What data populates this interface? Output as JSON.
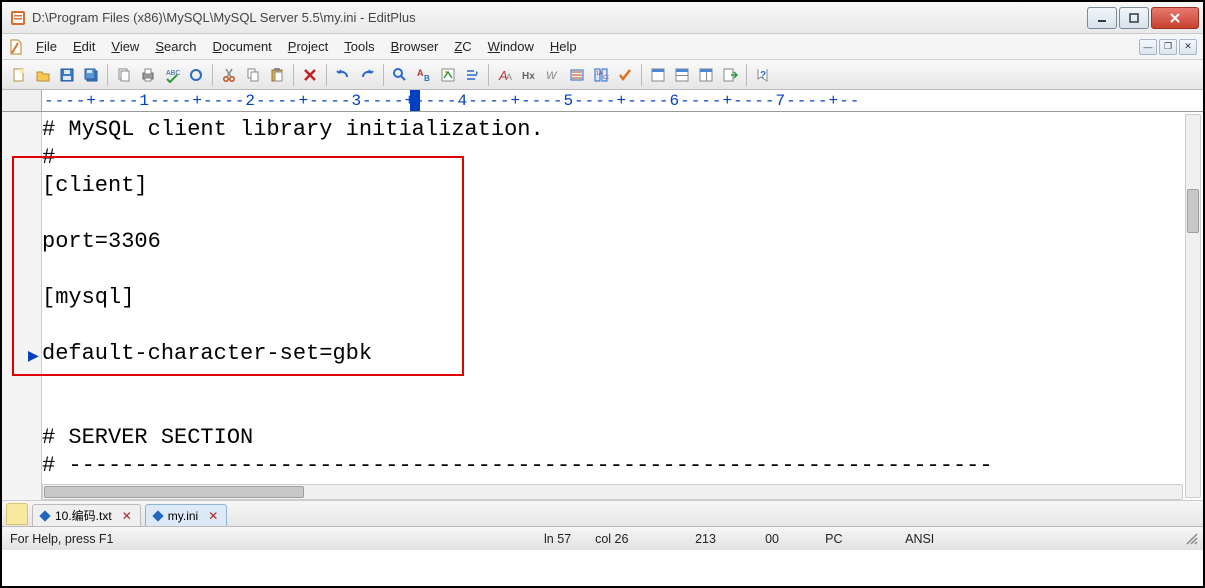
{
  "window": {
    "title": "D:\\Program Files (x86)\\MySQL\\MySQL Server 5.5\\my.ini - EditPlus"
  },
  "menus": [
    "File",
    "Edit",
    "View",
    "Search",
    "Document",
    "Project",
    "Tools",
    "Browser",
    "ZC",
    "Window",
    "Help"
  ],
  "ruler": "----+----1----+----2----+----3----+----4----+----5----+----6----+----7----+--",
  "editor_lines": [
    "# MySQL client library initialization.",
    "#",
    "[client]",
    "",
    "port=3306",
    "",
    "[mysql]",
    "",
    "default-character-set=gbk",
    "",
    "",
    "# SERVER SECTION",
    "# ----------------------------------------------------------------------"
  ],
  "doc_tabs": [
    {
      "label": "10.编码.txt",
      "active": false
    },
    {
      "label": "my.ini",
      "active": true
    }
  ],
  "status": {
    "help": "For Help, press F1",
    "line": "ln 57",
    "col": "col 26",
    "len": "213",
    "mode": "00",
    "pc": "PC",
    "enc": "ANSI"
  },
  "icons": {
    "app": "editplus",
    "toolbar": [
      "new",
      "open",
      "save",
      "saveall",
      "|",
      "copy",
      "print",
      "spell",
      "refresh",
      "|",
      "cut",
      "copy2",
      "paste",
      "|",
      "delete",
      "|",
      "undo",
      "redo",
      "|",
      "find",
      "findreplace",
      "browser",
      "toggle",
      "|",
      "fontA",
      "hex",
      "wrap",
      "bookmark",
      "compare",
      "check",
      "|",
      "window1",
      "window2",
      "window3",
      "export",
      "|",
      "help"
    ]
  }
}
